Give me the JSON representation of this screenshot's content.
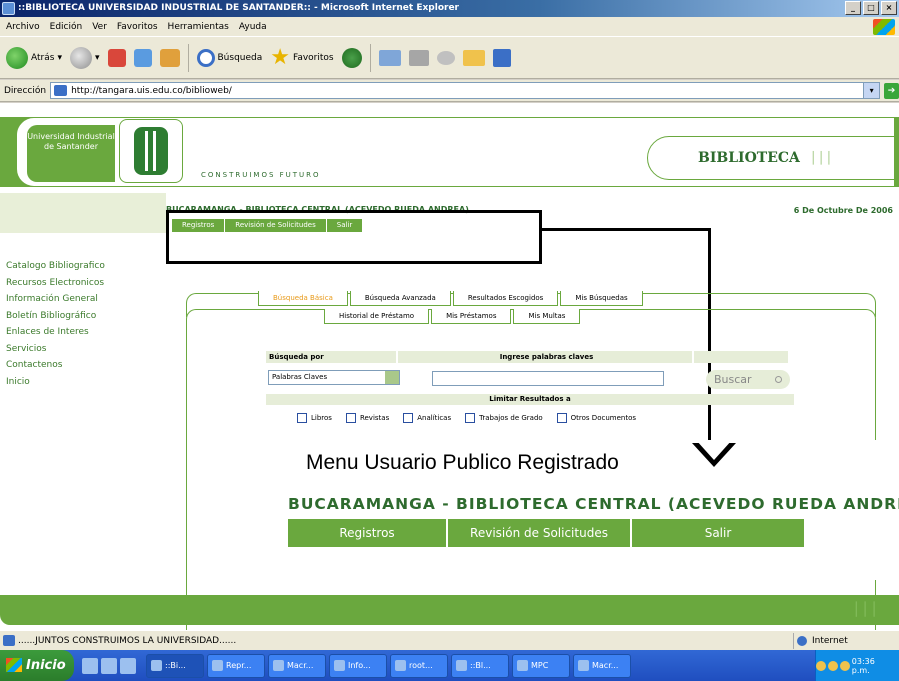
{
  "window": {
    "title": "::BIBLIOTECA UNIVERSIDAD INDUSTRIAL DE SANTANDER:: - Microsoft Internet Explorer",
    "controls": [
      "_",
      "□",
      "×"
    ]
  },
  "menubar": [
    "Archivo",
    "Edición",
    "Ver",
    "Favoritos",
    "Herramientas",
    "Ayuda"
  ],
  "toolbar": {
    "back": "Atrás",
    "search": "Búsqueda",
    "favorites": "Favoritos"
  },
  "address": {
    "label": "Dirección",
    "url": "http://tangara.uis.edu.co/biblioweb/",
    "go": "Ir"
  },
  "header": {
    "university": "Universidad Industrial de Santander",
    "slogan": "CONSTRUIMOS FUTURO",
    "section": "BIBLIOTECA"
  },
  "sidebar": {
    "items": [
      "Catalogo Bibliografico",
      "Recursos Electronicos",
      "Información General",
      "Boletín Bibliográfico",
      "Enlaces de Interes",
      "Servicios",
      "Contactenos",
      "Inicio"
    ]
  },
  "location": {
    "text": "BUCARAMANGA - BIBLIOTECA CENTRAL (ACEVEDO RUEDA ANDREA)",
    "menu": [
      "Registros",
      "Revisión de Solicitudes",
      "Salir"
    ],
    "date": "6 De Octubre De 2006"
  },
  "tabs": {
    "row1": [
      "Búsqueda Básica",
      "Búsqueda Avanzada",
      "Resultados Escogidos",
      "Mis Búsquedas"
    ],
    "row2": [
      "Historial de Préstamo",
      "Mis Préstamos",
      "Mis Multas"
    ]
  },
  "search": {
    "by_label": "Búsqueda por",
    "keywords_label": "Ingrese palabras claves",
    "select_value": "Palabras Claves",
    "button": "Buscar",
    "limit_label": "Limitar Resultados a",
    "filters": [
      "Libros",
      "Revistas",
      "Analíticas",
      "Trabajos de Grado",
      "Otros Documentos"
    ]
  },
  "zoom": {
    "caption": "Menu Usuario Publico Registrado",
    "location": "BUCARAMANGA - BIBLIOTECA CENTRAL (ACEVEDO RUEDA ANDREA)",
    "menu": [
      "Registros",
      "Revisión de Solicitudes",
      "Salir"
    ]
  },
  "statusbar": {
    "text": "......JUNTOS CONSTRUIMOS LA UNIVERSIDAD......",
    "zone": "Internet"
  },
  "taskbar": {
    "start": "Inicio",
    "buttons": [
      "::Bi...",
      "Repr...",
      "Macr...",
      "Info...",
      "root...",
      "::Bl...",
      "MPC",
      "Macr..."
    ],
    "clock": "03:36 p.m."
  },
  "colors": {
    "brand_green": "#6aa83e",
    "dark_green": "#2e6b2e",
    "active_tab": "#e89a1a"
  }
}
